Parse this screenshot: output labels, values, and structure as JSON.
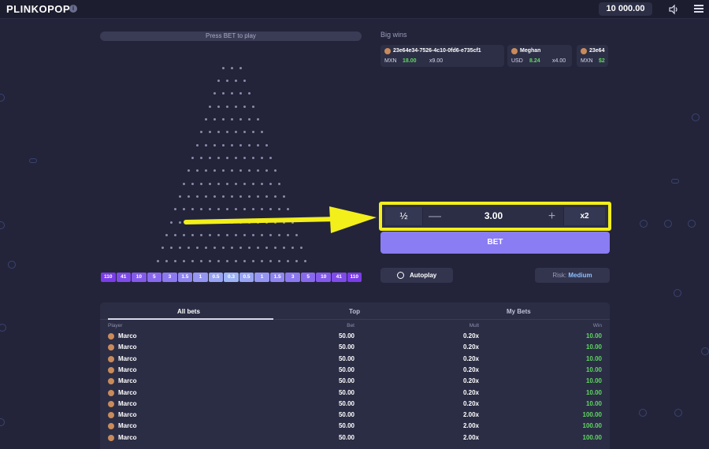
{
  "app": {
    "logo_main": "PLINKO",
    "logo_accent": "POP",
    "info_label": "i"
  },
  "header": {
    "balance": "10 000.00",
    "sound_icon": "speaker-icon",
    "menu_icon": "hamburger-icon"
  },
  "board": {
    "press_bet_text": "Press BET to play",
    "rows": 16,
    "multipliers": [
      "110",
      "41",
      "10",
      "5",
      "3",
      "1.5",
      "1",
      "0.5",
      "0.3",
      "0.5",
      "1",
      "1.5",
      "3",
      "5",
      "10",
      "41",
      "110"
    ]
  },
  "big_wins": {
    "title": "Big wins",
    "items": [
      {
        "user": "23e64e34-7526-4c10-0fd6-e735cf1",
        "currency": "MXN",
        "amount": "18.00",
        "mult": "x9.00"
      },
      {
        "user": "Meghan",
        "currency": "USD",
        "amount": "8.24",
        "mult": "x4.00"
      },
      {
        "user": "23e64",
        "currency": "MXN",
        "amount": "$2",
        "mult": ""
      }
    ]
  },
  "bet_controls": {
    "half_label": "½",
    "minus_label": "—",
    "value": "3.00",
    "plus_label": "+",
    "double_label": "x2",
    "bet_label": "BET",
    "autoplay_label": "Autoplay",
    "risk_label": "Risk:",
    "risk_value": "Medium"
  },
  "bets_table": {
    "tabs": [
      "All bets",
      "Top",
      "My Bets"
    ],
    "columns": {
      "player": "Player",
      "bet": "Bet",
      "mult": "Mult",
      "win": "Win"
    },
    "rows": [
      {
        "player": "Marco",
        "bet": "50.00",
        "mult": "0.20x",
        "win": "10.00"
      },
      {
        "player": "Marco",
        "bet": "50.00",
        "mult": "0.20x",
        "win": "10.00"
      },
      {
        "player": "Marco",
        "bet": "50.00",
        "mult": "0.20x",
        "win": "10.00"
      },
      {
        "player": "Marco",
        "bet": "50.00",
        "mult": "0.20x",
        "win": "10.00"
      },
      {
        "player": "Marco",
        "bet": "50.00",
        "mult": "0.20x",
        "win": "10.00"
      },
      {
        "player": "Marco",
        "bet": "50.00",
        "mult": "0.20x",
        "win": "10.00"
      },
      {
        "player": "Marco",
        "bet": "50.00",
        "mult": "0.20x",
        "win": "10.00"
      },
      {
        "player": "Marco",
        "bet": "50.00",
        "mult": "2.00x",
        "win": "100.00"
      },
      {
        "player": "Marco",
        "bet": "50.00",
        "mult": "2.00x",
        "win": "100.00"
      },
      {
        "player": "Marco",
        "bet": "50.00",
        "mult": "2.00x",
        "win": "100.00"
      }
    ]
  },
  "colors": {
    "accent": "#8a7cf2",
    "highlight": "#f2ef1b",
    "win_green": "#5fd85f",
    "mult_edge": "#7b5cf0",
    "mult_center": "#9db3f5"
  }
}
